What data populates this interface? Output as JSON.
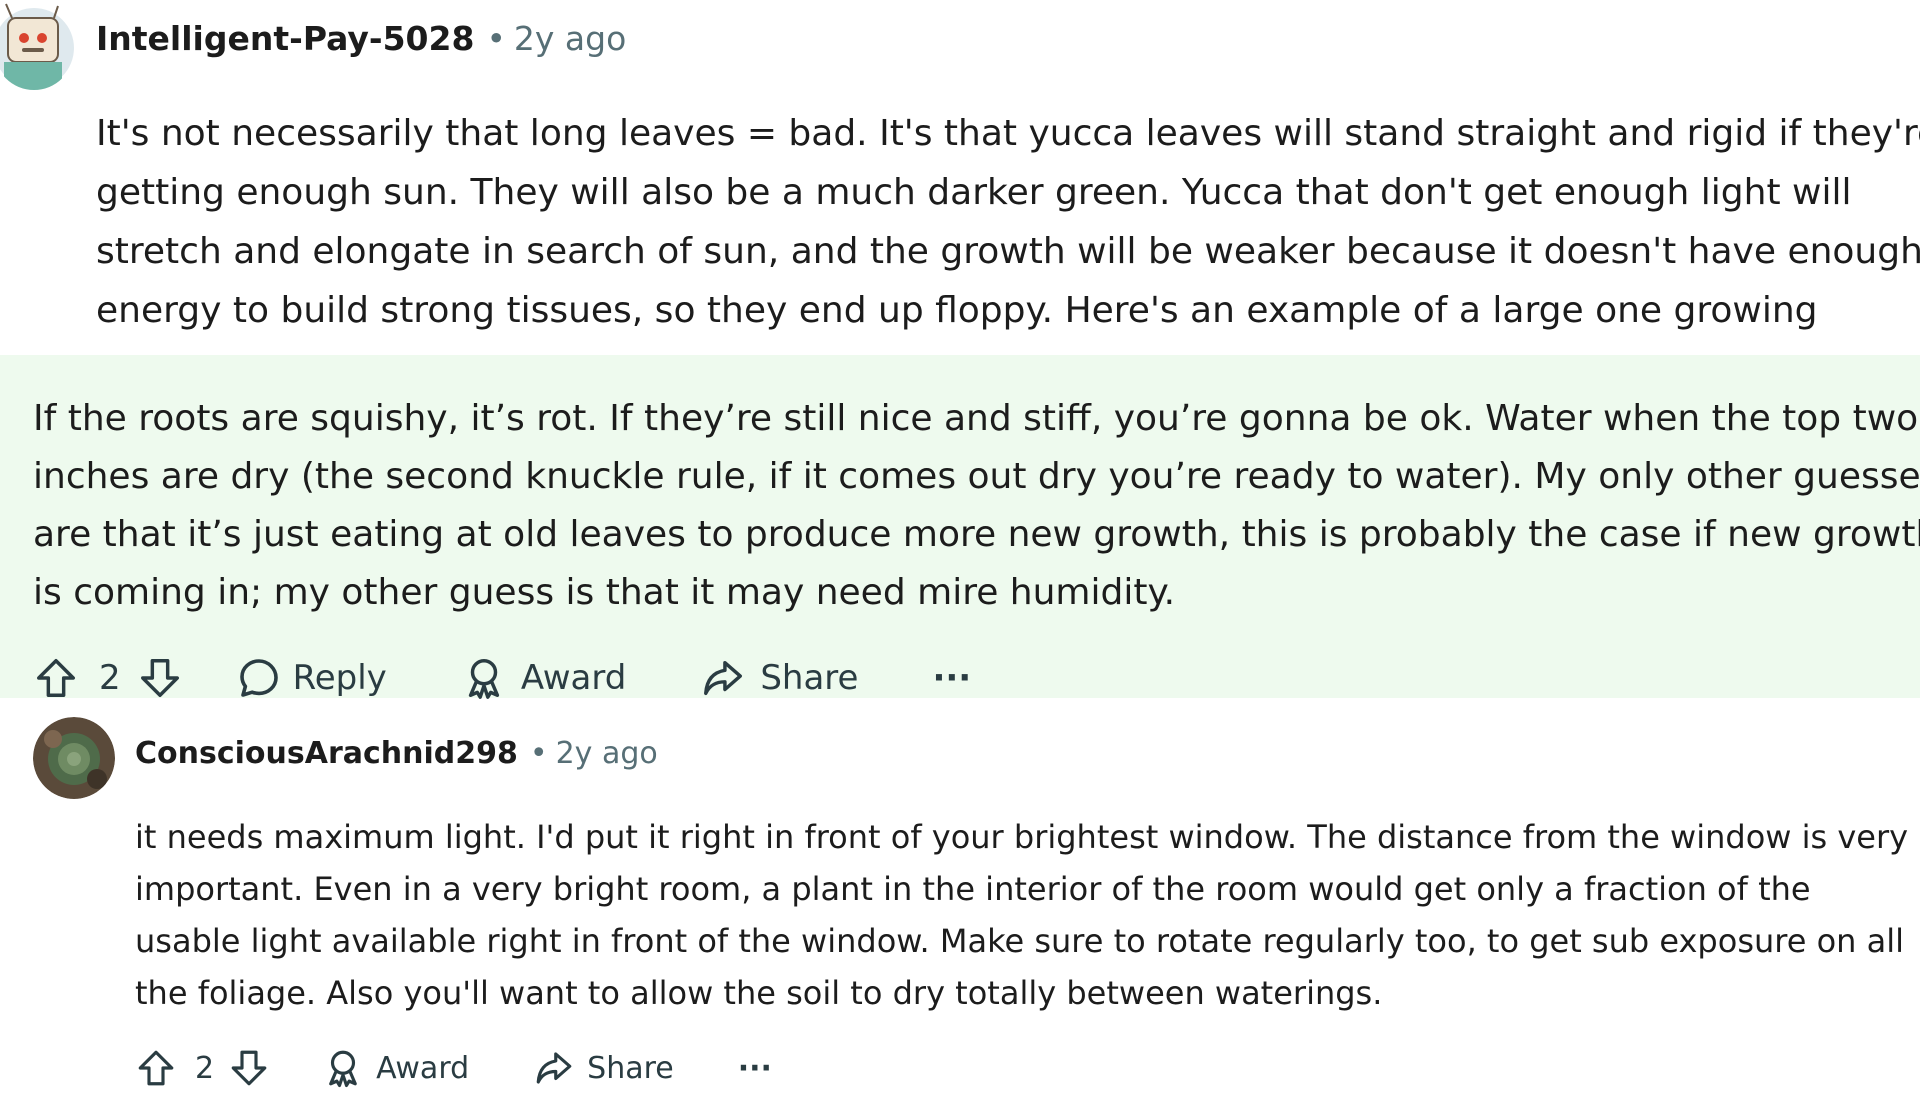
{
  "comment1": {
    "username": "Intelligent-Pay-5028",
    "separator": "•",
    "time": "2y ago",
    "lines": [
      "It's not necessarily that long leaves = bad. It's that yucca leaves will stand straight and rigid if they're",
      "getting enough sun. They will also be a much darker green. Yucca that don't get enough light will",
      "stretch and elongate in search of sun, and the growth will be weaker because it doesn't have enough",
      "energy to build strong tissues, so they end up floppy. Here's an example of a large one growing"
    ]
  },
  "comment2": {
    "lines": [
      "If the roots are squishy, it’s rot. If they’re still nice and stiff, you’re gonna be ok. Water when the top two",
      "inches are dry (the second knuckle rule, if it comes out dry you’re ready to water). My only other guesses",
      "are that it’s just eating at old leaves to produce more new growth, this is probably the case if new growth",
      "is coming in; my other guess is that it may need mire humidity."
    ],
    "actions": {
      "votes": "2",
      "reply": "Reply",
      "award": "Award",
      "share": "Share",
      "more": "···"
    }
  },
  "comment3": {
    "username": "ConsciousArachnid298",
    "separator": "•",
    "time": "2y ago",
    "lines": [
      "it needs maximum light. I'd put it right in front of your brightest window. The distance from the window is very",
      "important. Even in a very bright room, a plant in the interior of the room would get only a fraction of the",
      "usable light available right in front of the window. Make sure to rotate regularly too, to get sub exposure on all",
      "the foliage. Also you'll want to allow the soil to dry totally between waterings."
    ],
    "actions": {
      "votes": "2",
      "award": "Award",
      "share": "Share",
      "more": "···"
    }
  },
  "colors": {
    "highlight_bg": "#eefaee",
    "meta_text": "#576f76",
    "icon": "#2a3c42"
  }
}
